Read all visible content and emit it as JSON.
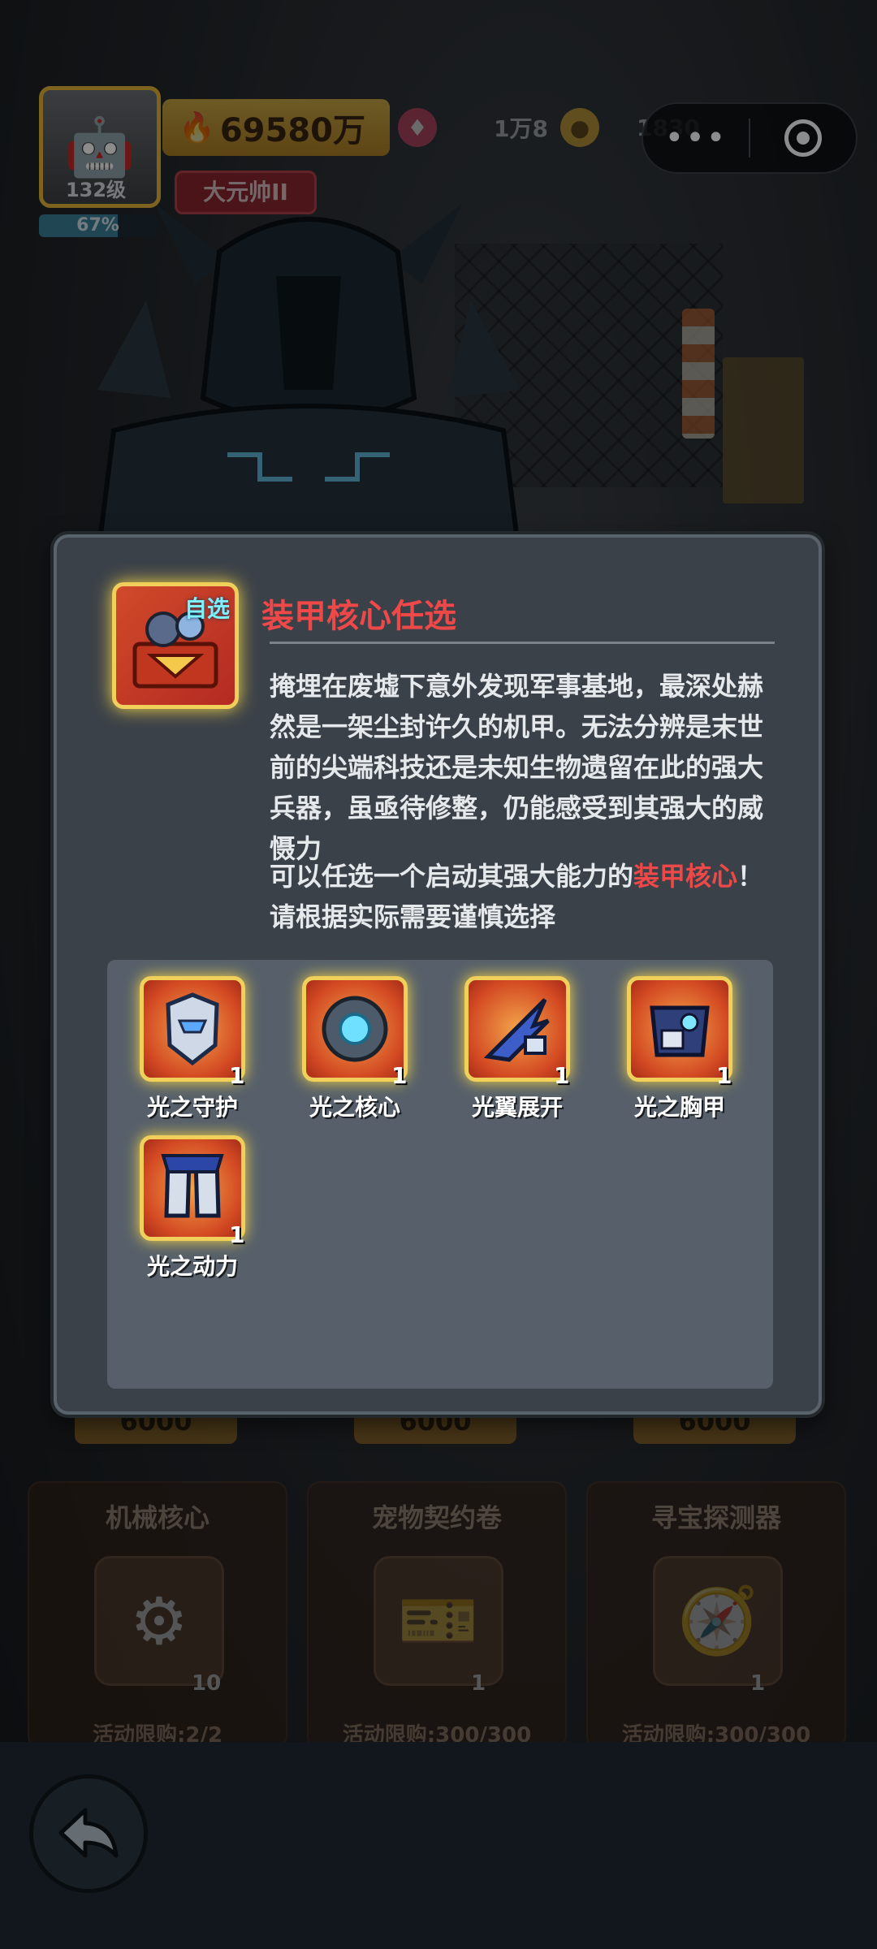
{
  "hud": {
    "level": "132级",
    "exp_percent": "67%",
    "exp_fraction": 0.67,
    "power": "69580万",
    "title_badge": "大元帅II",
    "gems": "1万8",
    "coins": "1830",
    "capsule_more": "•••"
  },
  "shop": {
    "cards": [
      {
        "name": "机械核心",
        "count": "10",
        "limit": "活动限购:2/2"
      },
      {
        "name": "宠物契约卷",
        "count": "1",
        "limit": "活动限购:300/300"
      },
      {
        "name": "寻宝探测器",
        "count": "1",
        "limit": "活动限购:300/300"
      }
    ],
    "price": "6000"
  },
  "dialog": {
    "chest_tag": "自选",
    "title": "装甲核心任选",
    "description": "掩埋在废墟下意外发现军事基地，最深处赫然是一架尘封许久的机甲。无法分辨是末世前的尖端科技还是未知生物遗留在此的强大兵器，虽亟待修整，仍能感受到其强大的威慑力",
    "note_prefix": "可以任选一个启动其强大能力的",
    "note_highlight": "装甲核心",
    "note_suffix": "！请根据实际需要谨慎选择",
    "items": [
      {
        "name": "光之守护",
        "qty": "1"
      },
      {
        "name": "光之核心",
        "qty": "1"
      },
      {
        "name": "光翼展开",
        "qty": "1"
      },
      {
        "name": "光之胸甲",
        "qty": "1"
      },
      {
        "name": "光之动力",
        "qty": "1"
      }
    ]
  }
}
